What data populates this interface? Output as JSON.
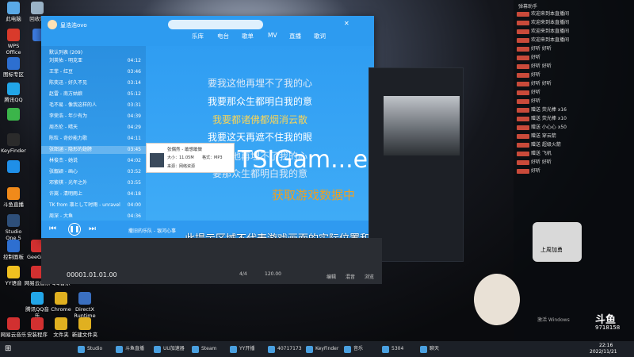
{
  "desktop_icons": [
    {
      "label": "此电脑",
      "color": "#5aa9e6"
    },
    {
      "label": "回收站",
      "color": "#9ab3c7"
    },
    {
      "label": "WPS Office",
      "color": "#d93a2b"
    },
    {
      "label": "",
      "color": "#3c7be0"
    },
    {
      "label": "图标专区",
      "color": "#2d6fd0"
    },
    {
      "label": "腾讯QQ",
      "color": "#22a6e8"
    },
    {
      "label": "",
      "color": "#3bb54a"
    },
    {
      "label": "KeyFinder",
      "color": "#2b2b2b"
    },
    {
      "label": "",
      "color": "#1f8fe8"
    },
    {
      "label": "斗鱼直播",
      "color": "#f08a1a"
    },
    {
      "label": "Studio One 5",
      "color": "#2e4f7a"
    },
    {
      "label": "控制面板",
      "color": "#2e6fd0"
    },
    {
      "label": "GeeGee",
      "color": "#d23030"
    },
    {
      "label": "YY语音",
      "color": "#f0c020"
    },
    {
      "label": "网易云音乐",
      "color": "#d23030"
    },
    {
      "label": "QQ音乐",
      "color": "#f0c020"
    },
    {
      "label": "腾讯QQ音乐",
      "color": "#22a6e8"
    },
    {
      "label": "Chrome",
      "color": "#e0b020"
    },
    {
      "label": "DirectX Runtime",
      "color": "#3a6fc0"
    },
    {
      "label": "网易云音乐",
      "color": "#d23030"
    },
    {
      "label": "安装程序",
      "color": "#d23030"
    },
    {
      "label": "文件夹",
      "color": "#e0b020"
    },
    {
      "label": "新建文件夹",
      "color": "#e0b020"
    }
  ],
  "player": {
    "user": "皇浩浩ovo",
    "search_placeholder": "",
    "tabs": [
      "乐库",
      "电台",
      "歌单",
      "MV",
      "直播",
      "歌词"
    ],
    "playlist_title": "默认列表 (209)",
    "songs": [
      {
        "title": "刘英佑 - 明克亚",
        "time": "04:12"
      },
      {
        "title": "王菲 - 红豆",
        "time": "03:46"
      },
      {
        "title": "陈奕迅 - 好久不见",
        "time": "03:14"
      },
      {
        "title": "赵雷 - 南方姑娘",
        "time": "05:12"
      },
      {
        "title": "毛不易 - 像我这样的人",
        "time": "03:31"
      },
      {
        "title": "李荣浩 - 年少有为",
        "time": "04:39"
      },
      {
        "title": "周杰伦 - 晴天",
        "time": "04:29"
      },
      {
        "title": "陈粒 - 奇妙能力歌",
        "time": "04:11"
      },
      {
        "title": "张韶涵 - 隐形的翅膀",
        "time": "03:45"
      },
      {
        "title": "林俊杰 - 她说",
        "time": "04:02"
      },
      {
        "title": "张靓颖 - 画心",
        "time": "03:52"
      },
      {
        "title": "邓紫棋 - 光年之外",
        "time": "03:55"
      },
      {
        "title": "许嵩 - 清明雨上",
        "time": "04:18"
      },
      {
        "title": "TK from 凛として时雨 - unravel",
        "time": "04:00"
      },
      {
        "title": "周深 - 大鱼",
        "time": "04:36"
      }
    ],
    "lyrics": [
      "要我这他再埋不了我的心",
      "我要那众生都明白我的意",
      "我要都诸佛都烟消云散",
      "我要这天再遮不住我的眼",
      "要这地再埋不了我的心",
      "要那众生都明白我的意"
    ],
    "popup": {
      "title": "张偶然 - 敢想敢做",
      "size": "大小：11.05M",
      "format": "格式：MP3",
      "source": "来源：网络资源"
    },
    "now_playing": "撒旧的乐队 - 银河心事",
    "controls": [
      "prev",
      "play",
      "next"
    ]
  },
  "overlay": {
    "game_name": "TSIGam...e",
    "loading": "获取游戏数据中",
    "notice": "此提示区域不代表游戏画面的实际位置和大小"
  },
  "daw": {
    "time": "00001.01.01.00",
    "tempo": "120.00",
    "signature": "4/4",
    "tabs": [
      "编辑",
      "混音",
      "浏览"
    ]
  },
  "chat": {
    "header": "弹幕助手",
    "messages": [
      "欢迎来到本直播间",
      "欢迎来到本直播间",
      "欢迎来到本直播间",
      "欢迎来到本直播间",
      "好听 好听",
      "好听",
      "好听 好听",
      "好听",
      "好听 好听",
      "好听",
      "好听",
      "赠送 荧光棒 x16",
      "赠送 荧光棒 x10",
      "赠送 小心心 x50",
      "赠送 穿云箭",
      "赠送 超级火箭",
      "赠送 飞机",
      "好听 好听",
      "好听"
    ],
    "banner": "上周加勇",
    "watermark": "斗鱼",
    "room_id": "9718158",
    "activate": "激活 Windows"
  },
  "taskbar": {
    "items": [
      "Studio One",
      "斗鱼直播",
      "UU加速器",
      "Steam",
      "YY开播",
      "40717173",
      "KeyFinder",
      "音乐",
      "5304",
      "聊天"
    ],
    "clock": "22:16",
    "date": "2022/11/21"
  }
}
